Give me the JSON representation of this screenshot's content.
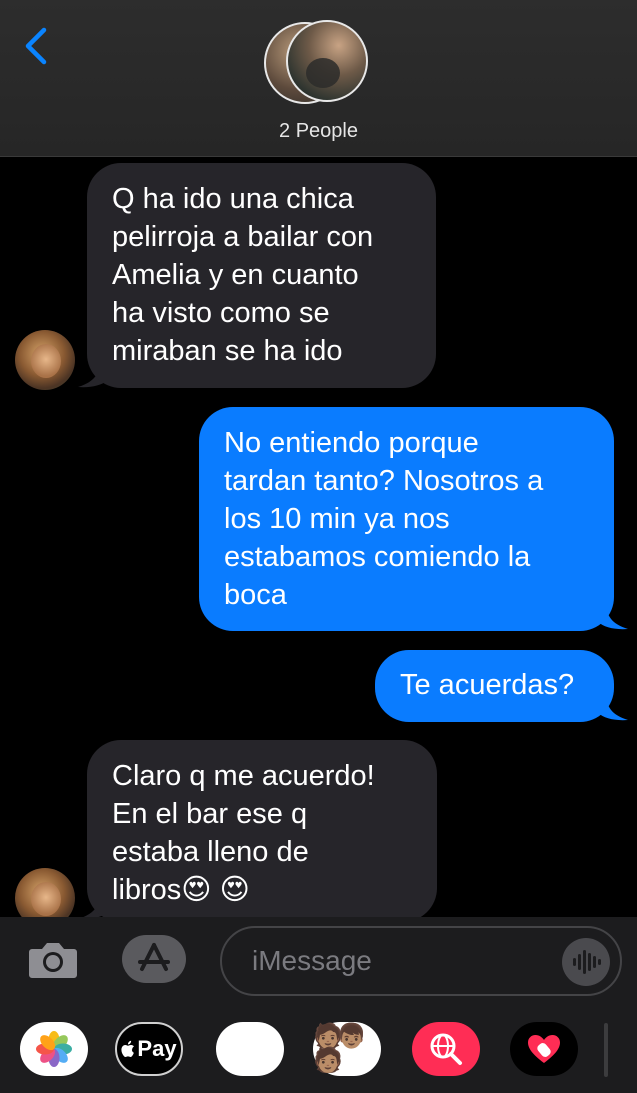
{
  "header": {
    "title": "2 People"
  },
  "messages": [
    {
      "direction": "incoming",
      "text": "Q ha ido una chica\npelirroja a bailar con\nAmelia y en cuanto\nha visto como se\nmiraban se ha ido"
    },
    {
      "direction": "outgoing",
      "text": "No entiendo porque\ntardan tanto? Nosotros a\nlos 10 min ya nos\nestabamos comiendo la\nboca"
    },
    {
      "direction": "outgoing",
      "text": "Te acuerdas?"
    },
    {
      "direction": "incoming",
      "text": "Claro q me acuerdo!\nEn el bar ese q\nestaba lleno de\nlibros😍 😍"
    }
  ],
  "input": {
    "placeholder": "iMessage"
  },
  "app_tray": {
    "apple_pay_label": "Pay"
  },
  "colors": {
    "accent": "#0a84ff",
    "outgoing_bubble": "#0a7cff",
    "incoming_bubble": "#26252a"
  }
}
